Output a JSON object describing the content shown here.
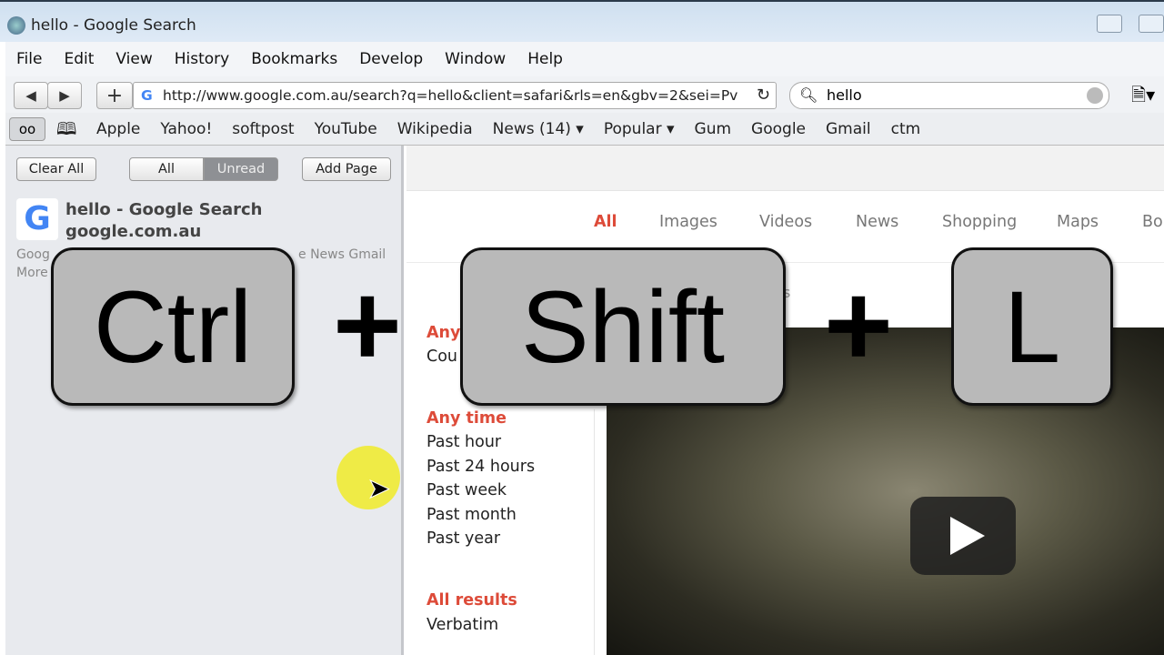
{
  "window": {
    "title": "hello - Google Search"
  },
  "menu": [
    "File",
    "Edit",
    "View",
    "History",
    "Bookmarks",
    "Develop",
    "Window",
    "Help"
  ],
  "toolbar": {
    "url": "http://www.google.com.au/search?q=hello&client=safari&rls=en&gbv=2&sei=Pv",
    "search_value": "hello"
  },
  "bookmarks": [
    "Apple",
    "Yahoo!",
    "softpost",
    "YouTube",
    "Wikipedia",
    "News (14) ▾",
    "Popular ▾",
    "Gum",
    "Google",
    "Gmail",
    "ctm"
  ],
  "reading_list": {
    "clear_all": "Clear All",
    "all": "All",
    "unread": "Unread",
    "add_page": "Add Page",
    "item": {
      "title": "hello - Google Search",
      "domain": "google.com.au",
      "snippet_left": "Goog",
      "snippet_right": "e News Gmail",
      "snippet_line2": "More"
    }
  },
  "google": {
    "tabs": [
      "All",
      "Images",
      "Videos",
      "News",
      "Shopping",
      "Maps",
      "Bo"
    ],
    "partial_s": "s",
    "filters": {
      "any_partial": "Any",
      "country_partial": "Cou",
      "time_heading": "Any time",
      "time_options": [
        "Past hour",
        "Past 24 hours",
        "Past week",
        "Past month",
        "Past year"
      ],
      "results_heading": "All results",
      "verbatim": "Verbatim"
    }
  },
  "overlay": {
    "keys": [
      "Ctrl",
      "Shift",
      "L"
    ],
    "plus": "+"
  },
  "colors": {
    "accent_red": "#dd4b39",
    "key_fill": "#b9b9b9",
    "cursor_highlight": "#f0eb28"
  }
}
